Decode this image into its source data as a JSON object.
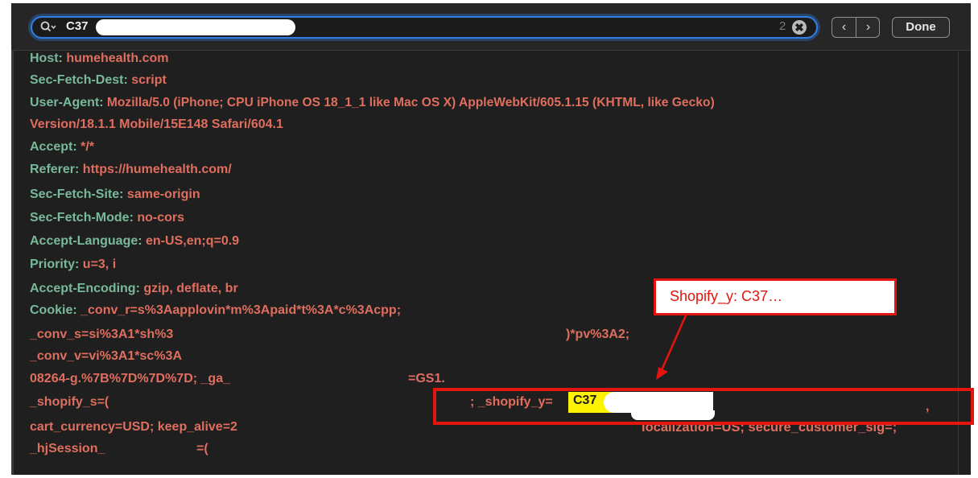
{
  "findbar": {
    "query": "C37",
    "match_count": "2",
    "clear_glyph": "✖",
    "prev_glyph": "‹",
    "next_glyph": "›",
    "done_label": "Done"
  },
  "headers": [
    {
      "key": "Host:",
      "value": " humehealth.com"
    },
    {
      "key": "Sec-Fetch-Dest:",
      "value": " script"
    },
    {
      "key": "User-Agent:",
      "value": " Mozilla/5.0 (iPhone; CPU iPhone OS 18_1_1 like Mac OS X) AppleWebKit/605.1.15 (KHTML, like Gecko)"
    },
    {
      "key": "",
      "value": "Version/18.1.1 Mobile/15E148 Safari/604.1"
    },
    {
      "key": "Accept:",
      "value": " */*"
    },
    {
      "key": "Referer:",
      "value": " https://humehealth.com/"
    },
    {
      "key": "Sec-Fetch-Site:",
      "value": " same-origin"
    },
    {
      "key": "Sec-Fetch-Mode:",
      "value": " no-cors"
    },
    {
      "key": "Accept-Language:",
      "value": " en-US,en;q=0.9"
    },
    {
      "key": "Priority:",
      "value": " u=3, i"
    },
    {
      "key": "Accept-Encoding:",
      "value": " gzip, deflate, br"
    },
    {
      "key": "Cookie:",
      "value": " _conv_r=s%3Aapplovin*m%3Apaid*t%3A*c%3Acpp;"
    }
  ],
  "cookie_lines": {
    "l1_a": "_conv_s=si%3A1*sh%3",
    "l1_b": ")*pv%3A2;",
    "l2_a": "_conv_v=vi%3A1*sc%3A",
    "l3_a": "08264-g.%7B%7D%7D%7D; _ga_",
    "l3_b": "=GS1.",
    "l4_a": "_shopify_s=(",
    "l4_b": "; _shopify_y=",
    "l4_c": ",",
    "l5_a": "cart_currency=USD; keep_alive=2",
    "l5_b": "localization=US; secure_customer_sig=;",
    "l6_a": "_hjSession_",
    "l6_b": "=("
  },
  "annotation": {
    "callout": "Shopify_y: C37…",
    "match": "C37"
  },
  "colors": {
    "header_key": "#78b99a",
    "header_value": "#e06e5e",
    "annotation_red": "#e4150f",
    "match_highlight": "#fdf200",
    "focus_ring": "#2f7fe5"
  }
}
